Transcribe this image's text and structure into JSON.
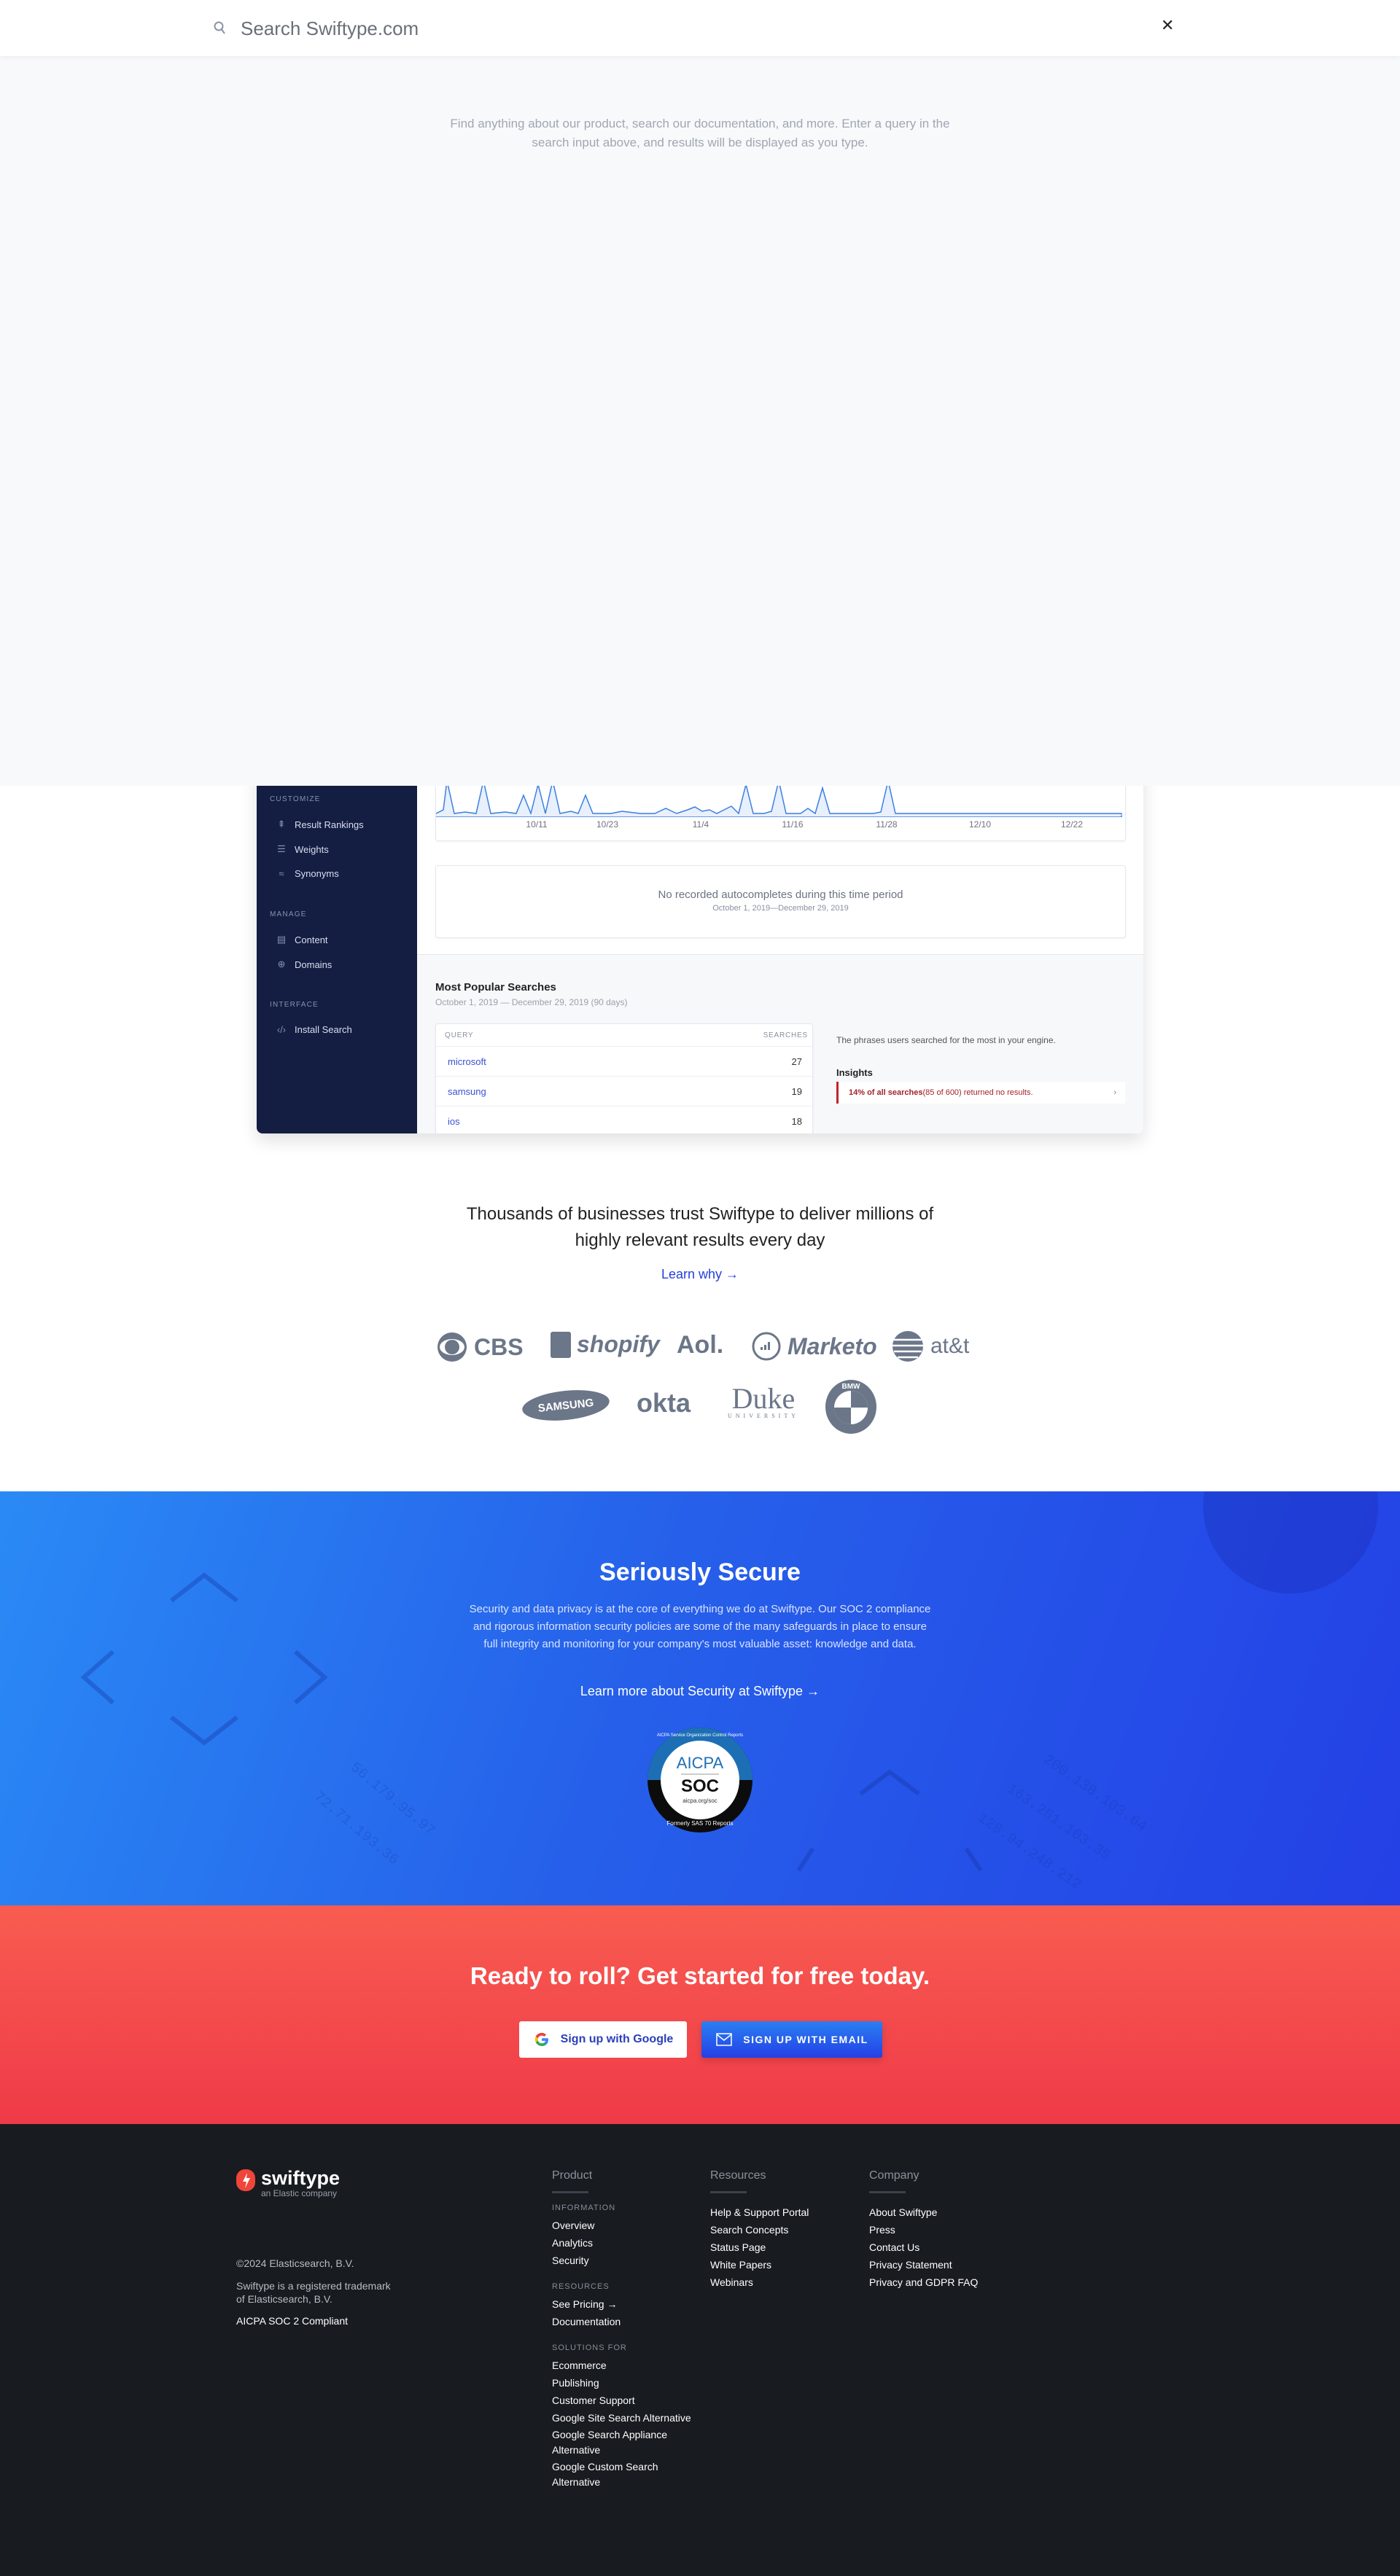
{
  "search": {
    "placeholder": "Search Swiftype.com",
    "hint": "Find anything about our product, search our documentation, and more. Enter a query in the search input above, and results will be displayed as you type."
  },
  "dashboard": {
    "sidebar": {
      "sections": [
        {
          "heading": "CUSTOMIZE",
          "items": [
            "Result Rankings",
            "Weights",
            "Synonyms"
          ]
        },
        {
          "heading": "MANAGE",
          "items": [
            "Content",
            "Domains"
          ]
        },
        {
          "heading": "INTERFACE",
          "items": [
            "Install Search"
          ]
        }
      ]
    },
    "chart_ticks": [
      "10/11",
      "10/23",
      "11/4",
      "11/16",
      "11/28",
      "12/10",
      "12/22"
    ],
    "autocomplete": {
      "message": "No recorded autocompletes during this time period",
      "range": "October 1, 2019—December 29, 2019"
    },
    "popular": {
      "title": "Most Popular Searches",
      "range": "October 1, 2019 — December 29, 2019 (90 days)",
      "col_query": "QUERY",
      "col_searches": "SEARCHES",
      "rows": [
        {
          "query": "microsoft",
          "count": "27"
        },
        {
          "query": "samsung",
          "count": "19"
        },
        {
          "query": "ios",
          "count": "18"
        }
      ],
      "description": "The phrases users searched for the most in your engine.",
      "insights_title": "Insights",
      "insight_bold": "14% of all searches",
      "insight_rest": " (85 of 600) returned no results."
    }
  },
  "trust": {
    "heading": "Thousands of businesses trust Swiftype to deliver millions of highly relevant results every day",
    "link": "Learn why →",
    "logos": [
      "CBS",
      "shopify",
      "Aol.",
      "Marketo",
      "at&t",
      "SAMSUNG",
      "okta",
      "Duke",
      "BMW"
    ],
    "duke_sub": "UNIVERSITY"
  },
  "security": {
    "title": "Seriously Secure",
    "body": "Security and data privacy is at the core of everything we do at Swiftype. Our SOC 2 compliance and rigorous information security policies are some of the many safeguards in place to ensure full integrity and monitoring for your company's most valuable asset: knowledge and data.",
    "link": "Learn more about Security at Swiftype →",
    "badge": {
      "top": "AICPA",
      "mid": "SOC",
      "url": "aicpa.org/soc",
      "ring": "AICPA Service Organization Control Reports",
      "bottom": "Formerly SAS 70 Reports"
    }
  },
  "cta": {
    "title": "Ready to roll? Get started for free today.",
    "google": "Sign up with Google",
    "email": "SIGN UP WITH EMAIL"
  },
  "footer": {
    "brand": "swiftype",
    "tagline": "an Elastic company",
    "copyright": "©2024 Elasticsearch, B.V.",
    "trademark": "Swiftype is a registered trademark of Elasticsearch, B.V.",
    "soc": "AICPA SOC 2 Compliant",
    "product": {
      "title": "Product",
      "groups": [
        {
          "heading": "INFORMATION",
          "links": [
            "Overview",
            "Analytics",
            "Security"
          ]
        },
        {
          "heading": "RESOURCES",
          "links": [
            "See Pricing →",
            "Documentation"
          ]
        },
        {
          "heading": "SOLUTIONS FOR",
          "links": [
            "Ecommerce",
            "Publishing",
            "Customer Support",
            "Google Site Search Alternative",
            "Google Search Appliance Alternative",
            "Google Custom Search Alternative"
          ]
        }
      ]
    },
    "resources": {
      "title": "Resources",
      "links": [
        "Help & Support Portal",
        "Search Concepts",
        "Status Page",
        "White Papers",
        "Webinars"
      ]
    },
    "company": {
      "title": "Company",
      "links": [
        "About Swiftype",
        "Press",
        "Contact Us",
        "Privacy Statement",
        "Privacy and GDPR FAQ"
      ]
    }
  },
  "colors": {
    "accent": "#2440e6",
    "cta": "#f04a4a",
    "footer": "#181b20",
    "sidebar": "#141e42"
  }
}
